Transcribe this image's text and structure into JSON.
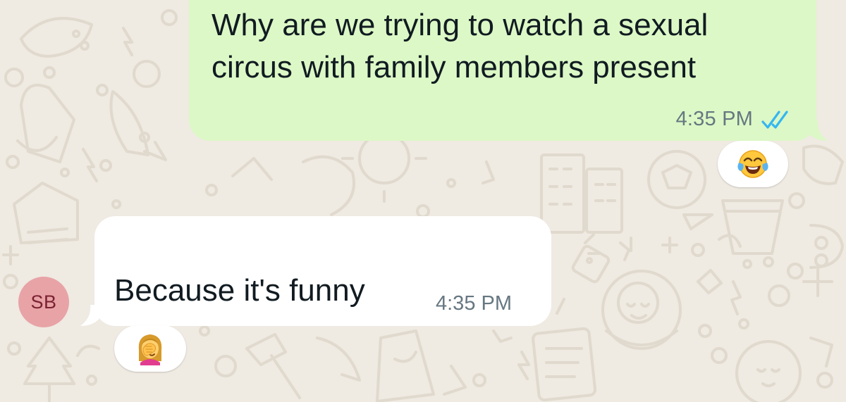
{
  "conversation": {
    "outgoing": {
      "text": "Why are we trying to watch a sexual circus with family members present",
      "time": "4:35 PM",
      "status_icon": "double-check-read-icon",
      "reaction_icon": "face-with-tears-of-joy-emoji"
    },
    "incoming": {
      "sender_initials": "SB",
      "text": "Because it's funny",
      "time": "4:35 PM",
      "reaction_icon": "woman-facepalming-emoji"
    }
  },
  "colors": {
    "background": "#efeae2",
    "outgoing_bubble": "#dcf8c6",
    "incoming_bubble": "#ffffff",
    "read_ticks": "#34b7f1",
    "avatar": "#e8a3a6",
    "avatar_text": "#7a2232",
    "timestamp": "#667781"
  }
}
